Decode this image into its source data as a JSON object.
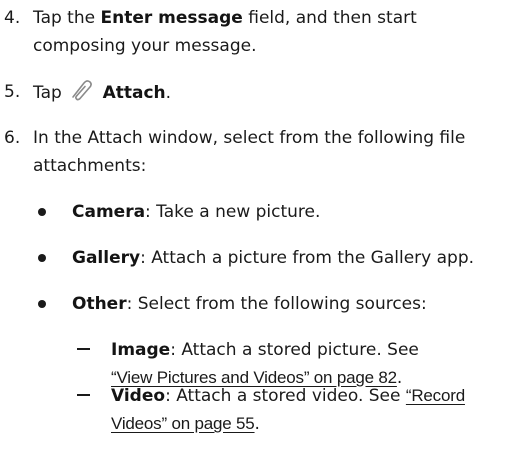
{
  "steps": [
    {
      "number": "4.",
      "pre": "Tap the ",
      "bold": "Enter message",
      "post_line1": " field, and then start",
      "line2": "composing your message."
    },
    {
      "number": "5.",
      "pre": "Tap",
      "icon": "paperclip-icon",
      "bold": "Attach",
      "post": "."
    },
    {
      "number": "6.",
      "line1": "In the Attach window, select from the following file",
      "line2": "attachments:"
    }
  ],
  "bullets": [
    {
      "bold": "Camera",
      "text": ": Take a new picture."
    },
    {
      "bold": "Gallery",
      "text": ": Attach a picture from the Gallery app."
    },
    {
      "bold": "Other",
      "text": ": Select from the following sources:"
    }
  ],
  "sub_items": [
    {
      "bold": "Image",
      "text_line1": ": Attach a stored picture. See",
      "link": "“View Pictures and Videos” on page 82",
      "after_link": "."
    },
    {
      "bold": "Video",
      "text_line1": ": Attach a stored video. See ",
      "link_line1": "“Record",
      "link_line2": "Videos” on page 55",
      "after_link": "."
    }
  ]
}
